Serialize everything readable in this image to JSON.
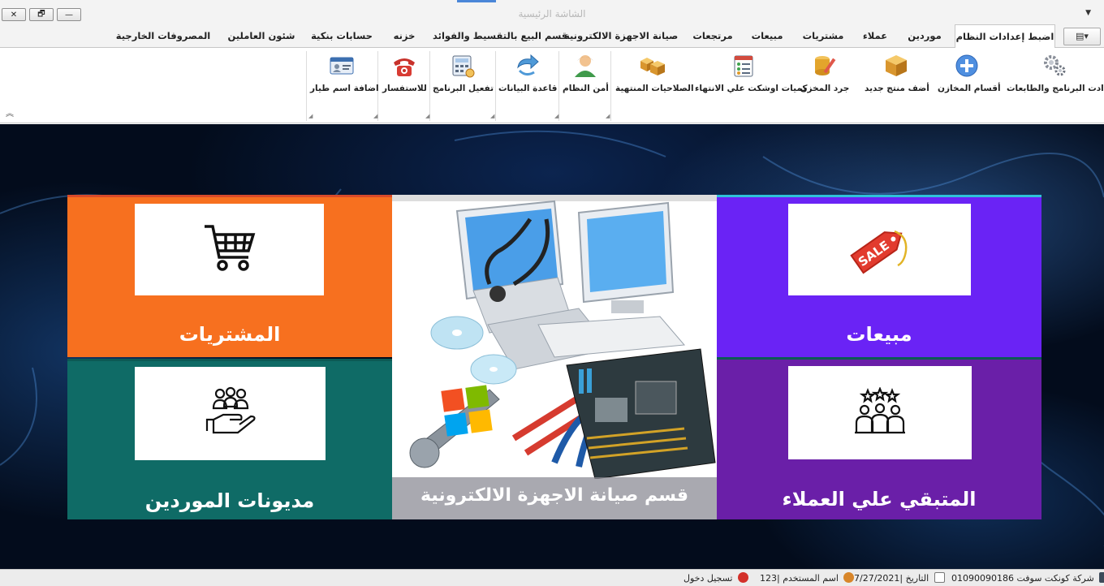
{
  "window": {
    "title": "الشاشة الرئيسية",
    "controls": {
      "close": "✕",
      "restore": "🗗",
      "minimize": "—"
    },
    "qat_arrow": "▼"
  },
  "app_menu_button": "▤▾",
  "tabs": [
    "اضبط إعدادات النظام",
    "موردين",
    "عملاء",
    "مشتريات",
    "مبيعات",
    "مرتجعات",
    "صيانة الاجهزة الالكترونية",
    "قسم البيع بالتقسيط والفوائد",
    "خزنه",
    "حسابات بنكية",
    "شئون العاملين",
    "المصروفات الخارجية"
  ],
  "ribbon": {
    "buttons": [
      {
        "label": "اعدادت البرنامج والطابعات",
        "icon": "gears-icon"
      },
      {
        "label": "أقسام المخازن",
        "icon": "add-icon"
      },
      {
        "label": "أضف منتج جديد",
        "icon": "box-icon"
      },
      {
        "label": "جرد المخزن",
        "icon": "inventory-icon"
      },
      {
        "label": "كميات اوشكت علي الانتهاء",
        "icon": "checklist-icon"
      },
      {
        "label": "الصلاحيات المنتهية",
        "icon": "boxes-icon"
      },
      {
        "label": "أمن النظام",
        "icon": "user-icon"
      },
      {
        "label": "قاعدة البيانات",
        "icon": "refresh-arrow-icon"
      },
      {
        "label": "تفعيل البرنامج",
        "icon": "calculator-icon"
      },
      {
        "label": "للاستفسار",
        "icon": "telephone-icon"
      },
      {
        "label": "اضافة اسم طيار",
        "icon": "id-card-icon"
      }
    ],
    "collapse_glyph": "︽",
    "launcher_glyph": "◢"
  },
  "tiles": {
    "purchases": {
      "label": "المشتريات",
      "icon": "shopping-cart-icon",
      "color": "#f7701f"
    },
    "sales": {
      "label": "مبيعات",
      "icon": "sale-tag-icon",
      "color": "#6a23f5"
    },
    "maintenance": {
      "label": "قسم صيانة الاجهزة الالكترونية",
      "icon": "computer-repair-image"
    },
    "supplier_debts": {
      "label": "مديونات الموردين",
      "icon": "people-hand-icon",
      "color": "#0f6b66"
    },
    "customer_balance": {
      "label": "المتبقي علي العملاء",
      "icon": "group-stars-icon",
      "color": "#6a1fa8"
    }
  },
  "status_bar": {
    "company": "شركة كونكت سوفت 01090090186",
    "date": "التاريخ |7/27/2021",
    "user": "اسم المستخدم |123",
    "login": "تسجيل دخول"
  }
}
